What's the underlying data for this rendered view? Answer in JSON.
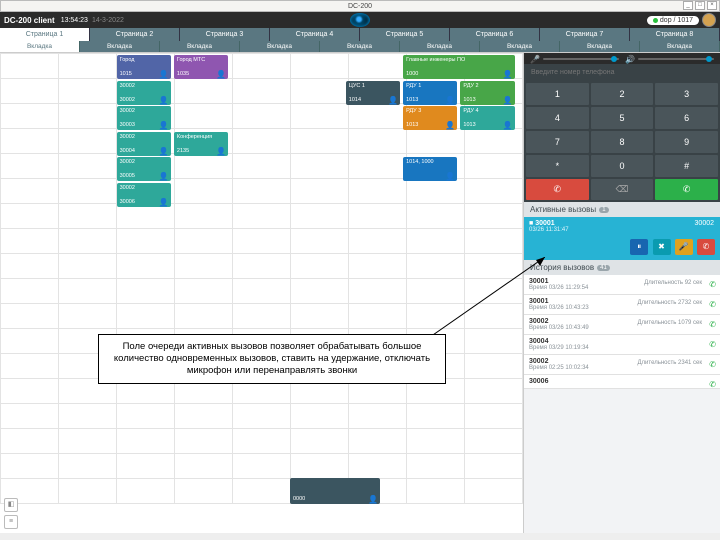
{
  "window": {
    "title": "DC-200"
  },
  "app": {
    "name": "DC-200 client",
    "time": "13:54:23",
    "date": "14-3-2022",
    "status": "dop / 1017"
  },
  "pages": [
    "Страница 1",
    "Страница 2",
    "Страница 3",
    "Страница 4",
    "Страница 5",
    "Страница 6",
    "Страница 7",
    "Страница 8"
  ],
  "tabs": [
    "Вкладка",
    "Вкладка",
    "Вкладка",
    "Вкладка",
    "Вкладка",
    "Вкладка",
    "Вкладка",
    "Вкладка",
    "Вкладка"
  ],
  "cards": [
    {
      "title": "Город",
      "num": "1015",
      "cls": "c-indigo",
      "col": 2,
      "row": 0
    },
    {
      "title": "Город МТС",
      "num": "1035",
      "cls": "c-purple",
      "col": 3,
      "row": 0
    },
    {
      "title": "Главные инженеры ПО",
      "num": "1000",
      "cls": "c-green",
      "col": 7,
      "row": 0,
      "w": 2
    },
    {
      "title": "30002",
      "num": "30002",
      "cls": "c-teal",
      "col": 2,
      "row": 1
    },
    {
      "title": "ЦУС 1",
      "num": "1014",
      "cls": "c-dark",
      "col": 6,
      "row": 1
    },
    {
      "title": "РДУ 1",
      "num": "1013",
      "cls": "c-blue",
      "col": 7,
      "row": 1
    },
    {
      "title": "РДУ 2",
      "num": "1013",
      "cls": "c-green",
      "col": 8,
      "row": 1
    },
    {
      "title": "30002",
      "num": "30003",
      "cls": "c-teal",
      "col": 2,
      "row": 2
    },
    {
      "title": "РДУ 3",
      "num": "1013",
      "cls": "c-orange",
      "col": 7,
      "row": 2
    },
    {
      "title": "РДУ 4",
      "num": "1013",
      "cls": "c-teal",
      "col": 8,
      "row": 2
    },
    {
      "title": "30002",
      "num": "30004",
      "cls": "c-teal",
      "col": 2,
      "row": 3
    },
    {
      "title": "Конференция",
      "num": "2135",
      "cls": "c-teal",
      "col": 3,
      "row": 3
    },
    {
      "title": "30002",
      "num": "30005",
      "cls": "c-teal",
      "col": 2,
      "row": 4
    },
    {
      "title": "1014, 1000",
      "num": "",
      "cls": "c-blue",
      "col": 7,
      "row": 4
    },
    {
      "title": "30002",
      "num": "30006",
      "cls": "c-teal",
      "col": 2,
      "row": 5
    }
  ],
  "dialer": {
    "placeholder": "Введите номер телефона",
    "keys": [
      "1",
      "2",
      "3",
      "4",
      "5",
      "6",
      "7",
      "8",
      "9",
      "*",
      "0",
      "#"
    ],
    "actions": {
      "hang": "✆",
      "clear": "⌫",
      "call": "✆"
    }
  },
  "active": {
    "header": "Активные вызовы",
    "count": "1",
    "caller": "30001",
    "target": "30002",
    "time": "03/26 11:31:47",
    "btns": [
      "⏸",
      "✖",
      "🎤",
      "✆"
    ]
  },
  "history": {
    "header": "История вызовов",
    "count": "41",
    "items": [
      {
        "n": "30001",
        "t": "Время 03/26 11:29:54",
        "d": "Длительность 92 сек"
      },
      {
        "n": "30001",
        "t": "Время 03/26 10:43:23",
        "d": "Длительность 2732 сек"
      },
      {
        "n": "30002",
        "t": "Время 03/26 10:43:49",
        "d": "Длительность 1079 сек"
      },
      {
        "n": "30004",
        "t": "Время 03/29 10:19:34",
        "d": ""
      },
      {
        "n": "30002",
        "t": "Время 02:25 10:02:34",
        "d": "Длительность 2341 сек"
      },
      {
        "n": "30006",
        "t": "",
        "d": ""
      }
    ]
  },
  "bigcard": {
    "title": "",
    "num": "0000"
  },
  "callout": "Поле очереди активных вызовов позволяет обрабатывать большое количество одновременных вызовов, ставить на удержание,\nотключать микрофон или перенаправлять звонки"
}
